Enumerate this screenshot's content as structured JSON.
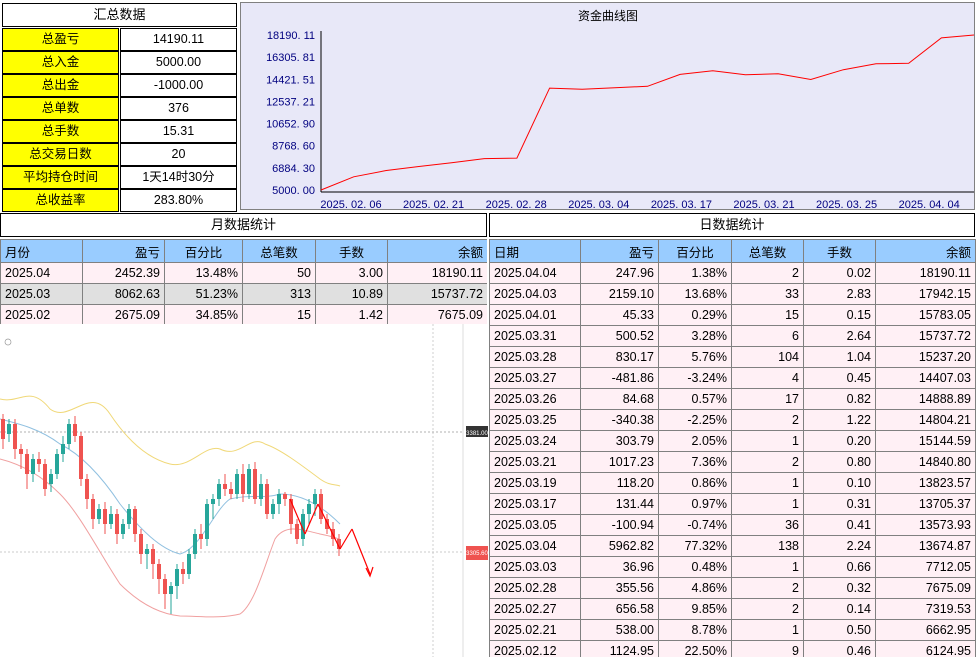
{
  "summary": {
    "title": "汇总数据",
    "rows": [
      {
        "label": "总盈亏",
        "value": "14190.11"
      },
      {
        "label": "总入金",
        "value": "5000.00"
      },
      {
        "label": "总出金",
        "value": "-1000.00"
      },
      {
        "label": "总单数",
        "value": "376"
      },
      {
        "label": "总手数",
        "value": "15.31"
      },
      {
        "label": "总交易日数",
        "value": "20"
      },
      {
        "label": "平均持仓时间",
        "value": "1天14时30分"
      },
      {
        "label": "总收益率",
        "value": "283.80%"
      }
    ]
  },
  "equity_chart": {
    "title": "资金曲线图",
    "y_ticks": [
      "18190. 11",
      "16305. 81",
      "14421. 51",
      "12537. 21",
      "10652. 90",
      "8768. 60",
      "6884. 30",
      "5000. 00"
    ],
    "x_ticks": [
      "2025. 02. 06",
      "2025. 02. 21",
      "2025. 02. 28",
      "2025. 03. 04",
      "2025. 03. 17",
      "2025. 03. 21",
      "2025. 03. 25",
      "2025. 04. 04"
    ],
    "colors": {
      "line": "#ff0000",
      "axis_text": "#000080",
      "background": "#e8e8f8"
    }
  },
  "chart_data": {
    "type": "line",
    "title": "资金曲线图",
    "ylim": [
      5000.0,
      18190.11
    ],
    "x": [
      "2025.02.06",
      "2025.02.12",
      "2025.02.13",
      "2025.02.17",
      "2025.02.19",
      "2025.02.20",
      "2025.02.21",
      "2025.02.27",
      "2025.02.28",
      "2025.03.03",
      "2025.03.04",
      "2025.03.05",
      "2025.03.17",
      "2025.03.19",
      "2025.03.21",
      "2025.03.24",
      "2025.03.25",
      "2025.03.26",
      "2025.03.27",
      "2025.03.28",
      "2025.03.31",
      "2025.04.01",
      "2025.04.03",
      "2025.04.04"
    ],
    "series": [
      {
        "values": [
          5000,
          6124.95,
          6662.95,
          7000,
          7319.53,
          7675.09,
          7712.05,
          13674.87,
          13573.93,
          13705.37,
          13823.57,
          14840.8,
          15144.59,
          14804.21,
          14888.89,
          14407.03,
          15237.2,
          15737.72,
          15783.05,
          17942.15,
          18190.11
        ]
      }
    ],
    "x_tick_labels": [
      "2025. 02. 06",
      "2025. 02. 21",
      "2025. 02. 28",
      "2025. 03. 04",
      "2025. 03. 17",
      "2025. 03. 21",
      "2025. 03. 25",
      "2025. 04. 04"
    ],
    "y_tick_labels": [
      "18190. 11",
      "16305. 81",
      "14421. 51",
      "12537. 21",
      "10652. 90",
      "8768. 60",
      "6884. 30",
      "5000. 00"
    ]
  },
  "monthly": {
    "title": "月数据统计",
    "headers": [
      "月份",
      "盈亏",
      "百分比",
      "总笔数",
      "手数",
      "余额"
    ],
    "rows": [
      [
        "2025.04",
        "2452.39",
        "13.48%",
        "50",
        "3.00",
        "18190.11"
      ],
      [
        "2025.03",
        "8062.63",
        "51.23%",
        "313",
        "10.89",
        "15737.72"
      ],
      [
        "2025.02",
        "2675.09",
        "34.85%",
        "15",
        "1.42",
        "7675.09"
      ]
    ]
  },
  "daily": {
    "title": "日数据统计",
    "headers": [
      "日期",
      "盈亏",
      "百分比",
      "总笔数",
      "手数",
      "余额"
    ],
    "rows": [
      [
        "2025.04.04",
        "247.96",
        "1.38%",
        "2",
        "0.02",
        "18190.11"
      ],
      [
        "2025.04.03",
        "2159.10",
        "13.68%",
        "33",
        "2.83",
        "17942.15"
      ],
      [
        "2025.04.01",
        "45.33",
        "0.29%",
        "15",
        "0.15",
        "15783.05"
      ],
      [
        "2025.03.31",
        "500.52",
        "3.28%",
        "6",
        "2.64",
        "15737.72"
      ],
      [
        "2025.03.28",
        "830.17",
        "5.76%",
        "104",
        "1.04",
        "15237.20"
      ],
      [
        "2025.03.27",
        "-481.86",
        "-3.24%",
        "4",
        "0.45",
        "14407.03"
      ],
      [
        "2025.03.26",
        "84.68",
        "0.57%",
        "17",
        "0.82",
        "14888.89"
      ],
      [
        "2025.03.25",
        "-340.38",
        "-2.25%",
        "2",
        "1.22",
        "14804.21"
      ],
      [
        "2025.03.24",
        "303.79",
        "2.05%",
        "1",
        "0.20",
        "15144.59"
      ],
      [
        "2025.03.21",
        "1017.23",
        "7.36%",
        "2",
        "0.80",
        "14840.80"
      ],
      [
        "2025.03.19",
        "118.20",
        "0.86%",
        "1",
        "0.10",
        "13823.57"
      ],
      [
        "2025.03.17",
        "131.44",
        "0.97%",
        "1",
        "0.31",
        "13705.37"
      ],
      [
        "2025.03.05",
        "-100.94",
        "-0.74%",
        "36",
        "0.41",
        "13573.93"
      ],
      [
        "2025.03.04",
        "5962.82",
        "77.32%",
        "138",
        "2.24",
        "13674.87"
      ],
      [
        "2025.03.03",
        "36.96",
        "0.48%",
        "1",
        "0.66",
        "7712.05"
      ],
      [
        "2025.02.28",
        "355.56",
        "4.86%",
        "2",
        "0.32",
        "7675.09"
      ],
      [
        "2025.02.27",
        "656.58",
        "9.85%",
        "2",
        "0.14",
        "7319.53"
      ],
      [
        "2025.02.21",
        "538.00",
        "8.78%",
        "1",
        "0.50",
        "6662.95"
      ],
      [
        "2025.02.12",
        "1124.95",
        "22.50%",
        "9",
        "0.46",
        "6124.95"
      ]
    ]
  },
  "overlay_chart": {
    "colors": {
      "up": "#26a69a",
      "down": "#ef5350",
      "band_upper": "#f0d878",
      "band_mid": "#90c0e0",
      "band_lower": "#f0a0a0",
      "arrow": "#ff0000"
    },
    "price_tag_current": "3305.60",
    "price_tag_marker": "3381.00"
  }
}
